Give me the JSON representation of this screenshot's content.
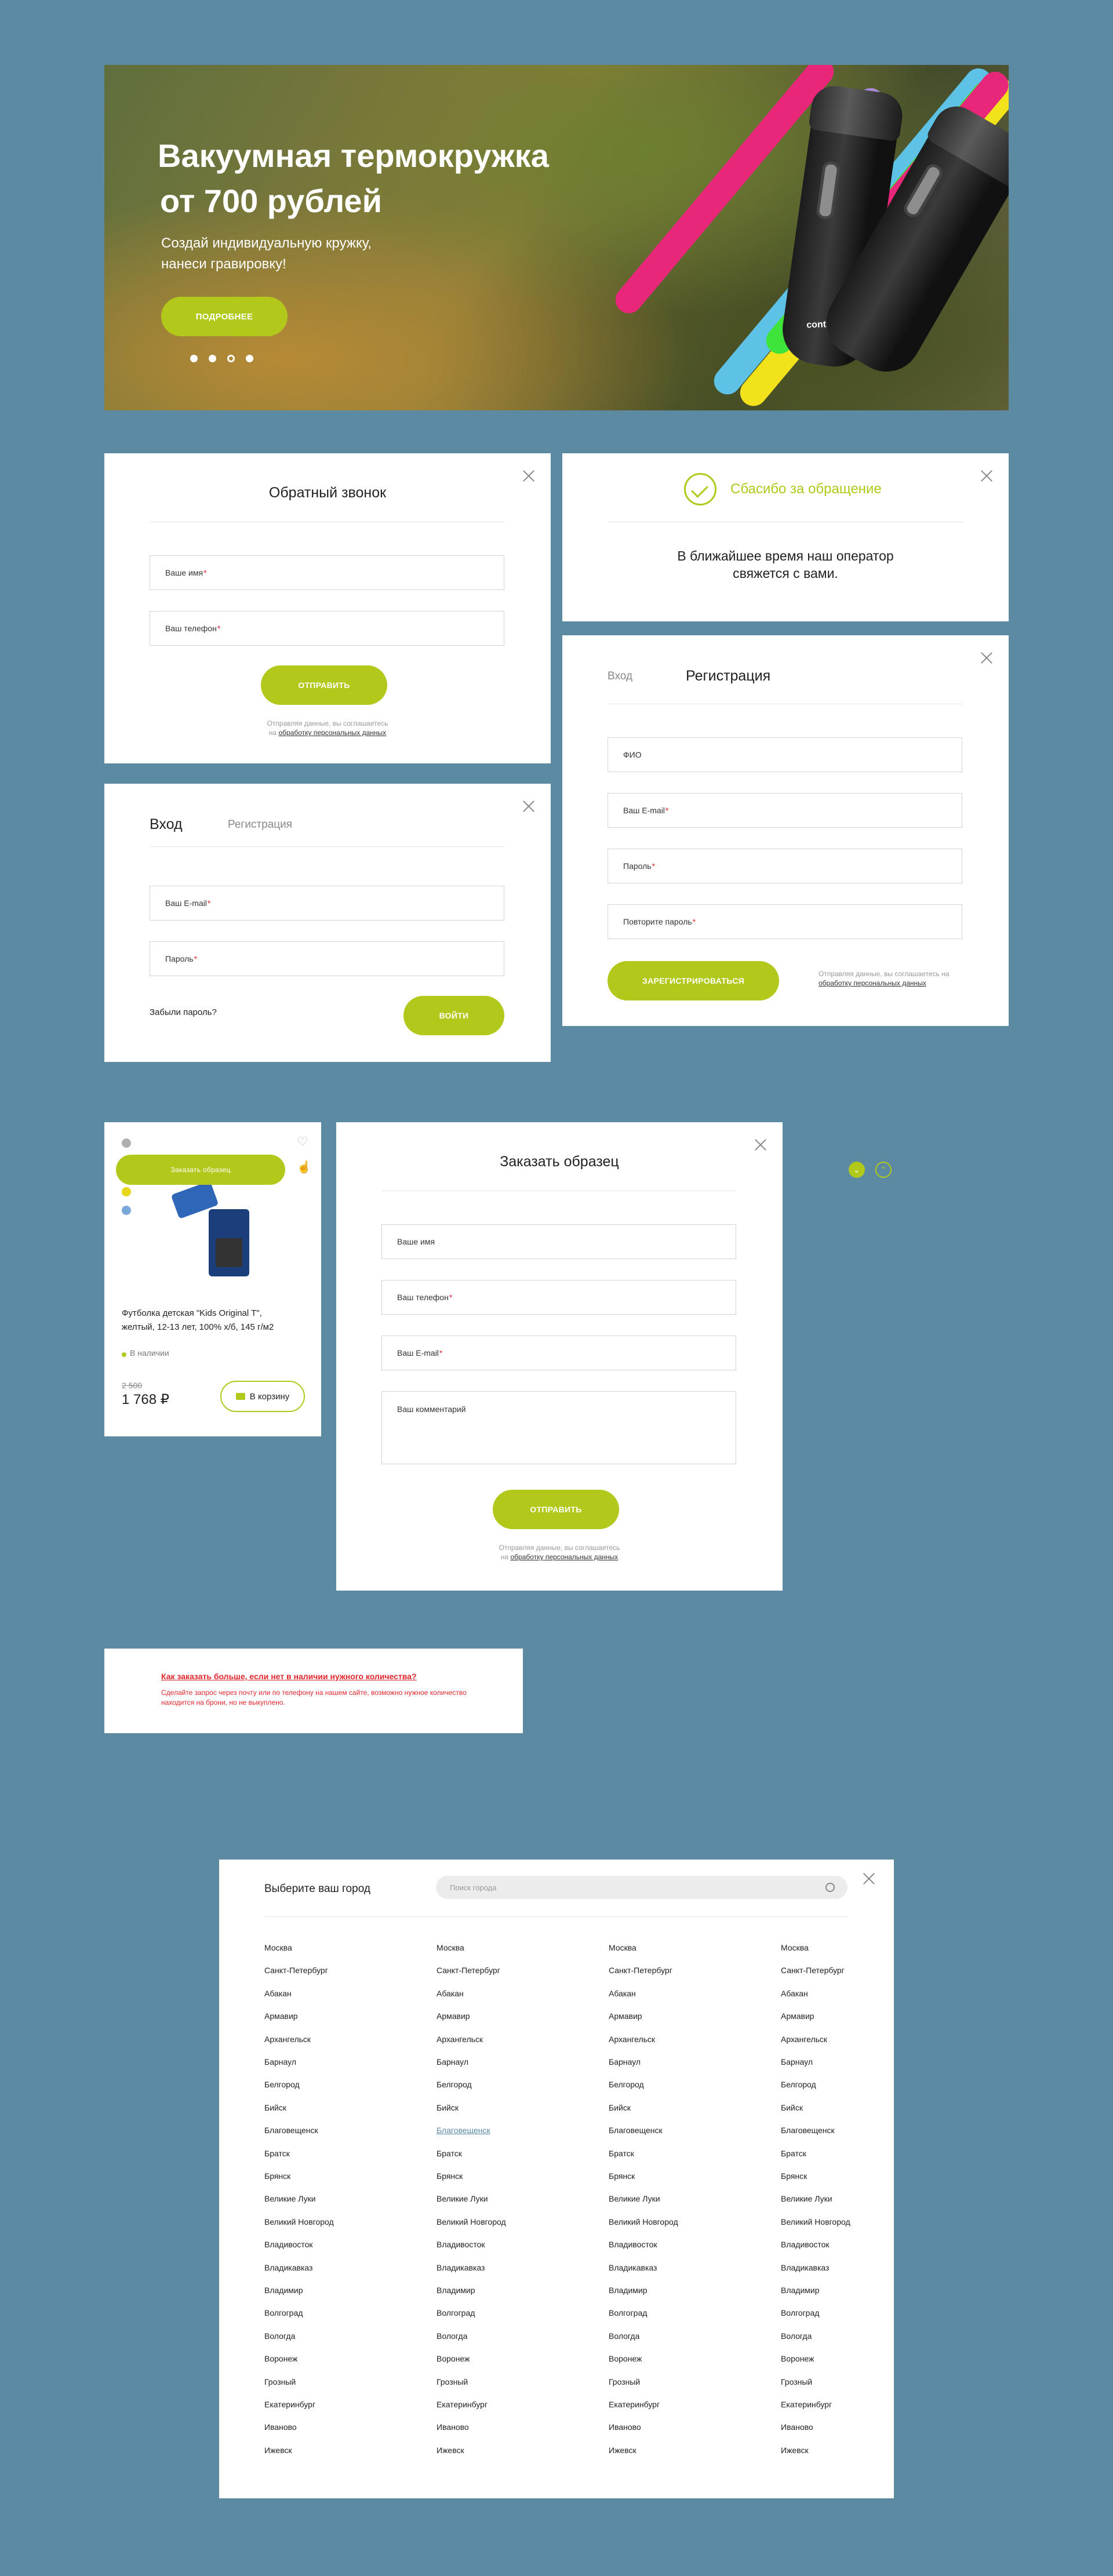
{
  "hero": {
    "title_line1": "Вакуумная термокружка",
    "title_line2": "от 700 рублей",
    "subtitle_line1": "Создай индивидуальную кружку,",
    "subtitle_line2": "нанеси гравировку!",
    "button": "ПОДРОБНЕЕ",
    "brand": "contigo"
  },
  "callback": {
    "title": "Обратный звонок",
    "name_label": "Ваше имя",
    "phone_label": "Ваш телефон",
    "button": "ОТПРАВИТЬ",
    "consent_line1": "Отправляя данные, вы соглашаетесь",
    "consent_pre": "на ",
    "consent_link": "обработку персональных данных"
  },
  "thanks": {
    "title": "Сбасибо за обращение",
    "message_line1": "В ближайшее время наш оператор",
    "message_line2": "свяжется с вами."
  },
  "register": {
    "tab_login": "Вход",
    "tab_register": "Регистрация",
    "fio_label": "ФИО",
    "email_label": "Ваш E-mail",
    "password_label": "Пароль",
    "repeat_label": "Повторите пароль",
    "button": "ЗАРЕГИСТРИРОВАТЬСЯ",
    "consent_line1": "Отправляя данные, вы соглашаетесь на",
    "consent_link": "обработку персональных данных"
  },
  "login": {
    "tab_login": "Вход",
    "tab_register": "Регистрация",
    "email_label": "Ваш E-mail",
    "password_label": "Пароль",
    "forgot": "Забыли пароль?",
    "button": "ВОЙТИ"
  },
  "product": {
    "order_sample": "Заказать образец",
    "name_line1": "Футболка детская \"Kids Original T\",",
    "name_line2": "желтый, 12-13 лет, 100% х/б, 145 г/м2",
    "stock": "В наличии",
    "old_price": "2 500",
    "price": "1 768 ₽",
    "cart_button": "В корзину",
    "colors": [
      "#b0b0b0",
      "#e0262d",
      "#e8d61a",
      "#7aa8d8"
    ]
  },
  "sample": {
    "title": "Заказать образец",
    "name_label": "Ваше имя",
    "phone_label": "Ваш телефон",
    "email_label": "Ваш E-mail",
    "comment_label": "Ваш комментарий",
    "button": "ОТПРАВИТЬ",
    "consent_line1": "Отправляя данные, вы соглашаетесь",
    "consent_pre": "на ",
    "consent_link": "обработку персональных данных"
  },
  "notice": {
    "title": "Как заказать больше, если нет в наличии нужного количества?",
    "text_line1": "Сделайте запрос через почту или по телефону на нашем сайте, возможно нужное количество",
    "text_line2": "находится на брони, но не выкуплено."
  },
  "city_select": {
    "title": "Выберите ваш город",
    "search_placeholder": "Поиск города",
    "active_city": "Благовещенск",
    "cities": [
      "Москва",
      "Санкт-Петербург",
      "Абакан",
      "Армавир",
      "Архангельск",
      "Барнаул",
      "Белгород",
      "Бийск",
      "Благовещенск",
      "Братск",
      "Брянск",
      "Великие Луки",
      "Великий Новгород",
      "Владивосток",
      "Владикавказ",
      "Владимир",
      "Волгоград",
      "Вологда",
      "Воронеж",
      "Грозный",
      "Екатеринбург",
      "Иваново",
      "Ижевск"
    ]
  },
  "colors": {
    "accent": "#b2c81a",
    "background": "#5b8aa2",
    "required": "#e0262d",
    "notice": "#e0262d"
  }
}
